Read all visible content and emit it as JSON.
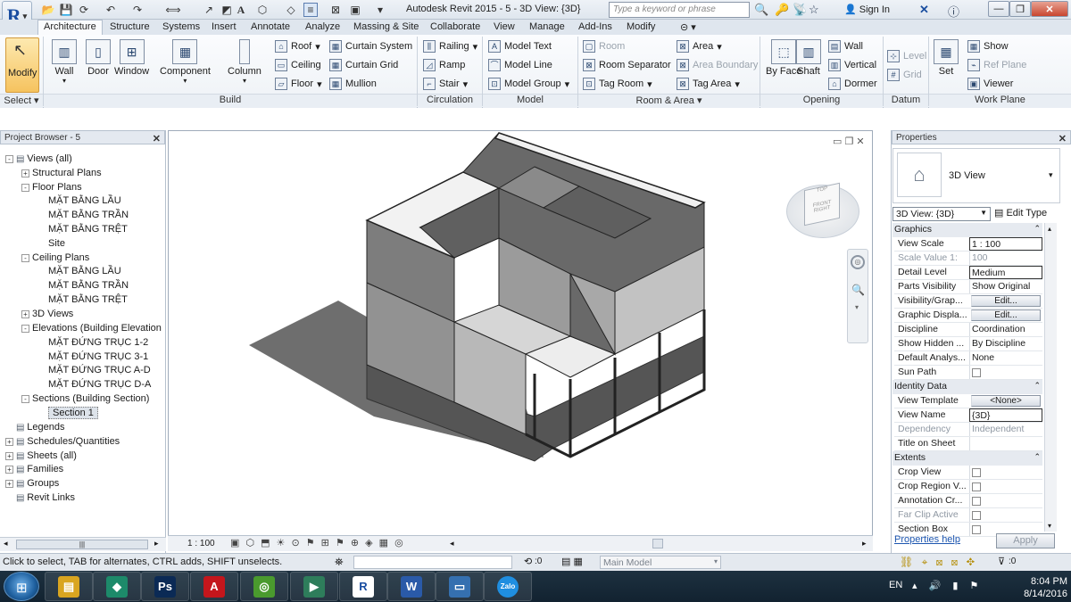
{
  "title_bar": {
    "app_button_letter": "R",
    "window_title": "Autodesk Revit 2015  -  5 - 3D View: {3D}",
    "search_placeholder": "Type a keyword or phrase",
    "sign_in": "Sign In"
  },
  "ribbon_tabs": [
    "Architecture",
    "Structure",
    "Systems",
    "Insert",
    "Annotate",
    "Analyze",
    "Massing & Site",
    "Collaborate",
    "View",
    "Manage",
    "Add-Ins",
    "Modify"
  ],
  "active_tab": "Architecture",
  "ribbon": {
    "select_panel": {
      "modify": "Modify",
      "footer": "Select"
    },
    "build_panel": {
      "wall": "Wall",
      "door": "Door",
      "window": "Window",
      "component": "Component",
      "column": "Column",
      "roof": "Roof",
      "ceiling": "Ceiling",
      "floor": "Floor",
      "curtain_system": "Curtain System",
      "curtain_grid": "Curtain Grid",
      "mullion": "Mullion",
      "footer": "Build"
    },
    "circulation_panel": {
      "railing": "Railing",
      "ramp": "Ramp",
      "stair": "Stair",
      "footer": "Circulation"
    },
    "model_panel": {
      "model_text": "Model Text",
      "model_line": "Model Line",
      "model_group": "Model Group",
      "footer": "Model"
    },
    "room_area_panel": {
      "room": "Room",
      "room_separator": "Room Separator",
      "tag_room": "Tag Room",
      "area": "Area",
      "area_boundary": "Area Boundary",
      "tag_area": "Tag Area",
      "footer": "Room & Area"
    },
    "opening_panel": {
      "by_face": "By Face",
      "shaft": "Shaft",
      "wall": "Wall",
      "vertical": "Vertical",
      "dormer": "Dormer",
      "footer": "Opening"
    },
    "datum_panel": {
      "level": "Level",
      "grid": "Grid",
      "footer": "Datum"
    },
    "work_plane_panel": {
      "set": "Set",
      "show": "Show",
      "ref_plane": "Ref Plane",
      "viewer": "Viewer",
      "footer": "Work Plane"
    }
  },
  "project_browser": {
    "title": "Project Browser - 5",
    "nodes": [
      {
        "label": "Views (all)",
        "indent": 0,
        "toggle": "-"
      },
      {
        "label": "Structural Plans",
        "indent": 1,
        "toggle": "+"
      },
      {
        "label": "Floor Plans",
        "indent": 1,
        "toggle": "-"
      },
      {
        "label": "MẶT BẰNG LẦU",
        "indent": 2,
        "toggle": ""
      },
      {
        "label": "MẶT BẰNG TRẦN",
        "indent": 2,
        "toggle": ""
      },
      {
        "label": "MẶT BẰNG TRỆT",
        "indent": 2,
        "toggle": ""
      },
      {
        "label": "Site",
        "indent": 2,
        "toggle": ""
      },
      {
        "label": "Ceiling Plans",
        "indent": 1,
        "toggle": "-"
      },
      {
        "label": "MẶT BẰNG LẦU",
        "indent": 2,
        "toggle": ""
      },
      {
        "label": "MẶT BẰNG TRẦN",
        "indent": 2,
        "toggle": ""
      },
      {
        "label": "MẶT BẰNG TRỆT",
        "indent": 2,
        "toggle": ""
      },
      {
        "label": "3D Views",
        "indent": 1,
        "toggle": "+"
      },
      {
        "label": "Elevations (Building Elevation",
        "indent": 1,
        "toggle": "-"
      },
      {
        "label": "MẶT ĐỨNG TRỤC 1-2",
        "indent": 2,
        "toggle": ""
      },
      {
        "label": "MẶT ĐỨNG TRỤC 3-1",
        "indent": 2,
        "toggle": ""
      },
      {
        "label": "MẶT ĐỨNG TRỤC A-D",
        "indent": 2,
        "toggle": ""
      },
      {
        "label": "MẶT ĐỨNG TRỤC D-A",
        "indent": 2,
        "toggle": ""
      },
      {
        "label": "Sections (Building Section)",
        "indent": 1,
        "toggle": "-"
      },
      {
        "label": "Section 1",
        "indent": 2,
        "toggle": "",
        "selected": true
      },
      {
        "label": "Legends",
        "indent": 0,
        "toggle": ""
      },
      {
        "label": "Schedules/Quantities",
        "indent": 0,
        "toggle": "+"
      },
      {
        "label": "Sheets (all)",
        "indent": 0,
        "toggle": "+"
      },
      {
        "label": "Families",
        "indent": 0,
        "toggle": "+"
      },
      {
        "label": "Groups",
        "indent": 0,
        "toggle": "+"
      },
      {
        "label": "Revit Links",
        "indent": 0,
        "toggle": ""
      }
    ]
  },
  "view_control": {
    "scale": "1 : 100"
  },
  "view_cube": {
    "top": "TOP",
    "front": "FRONT",
    "right": "RIGHT"
  },
  "properties": {
    "title": "Properties",
    "type_name": "3D View",
    "selector_value": "3D View: {3D}",
    "edit_type": "Edit Type",
    "groups": [
      {
        "name": "Graphics",
        "rows": [
          {
            "k": "View Scale",
            "v": "1 : 100",
            "input": true
          },
          {
            "k": "Scale Value    1:",
            "v": "100",
            "dim": true
          },
          {
            "k": "Detail Level",
            "v": "Medium",
            "input": true
          },
          {
            "k": "Parts Visibility",
            "v": "Show Original"
          },
          {
            "k": "Visibility/Grap...",
            "v": "Edit...",
            "button": true
          },
          {
            "k": "Graphic Displa...",
            "v": "Edit...",
            "button": true
          },
          {
            "k": "Discipline",
            "v": "Coordination"
          },
          {
            "k": "Show Hidden ...",
            "v": "By Discipline"
          },
          {
            "k": "Default Analys...",
            "v": "None"
          },
          {
            "k": "Sun Path",
            "v": "",
            "checkbox": true
          }
        ]
      },
      {
        "name": "Identity Data",
        "rows": [
          {
            "k": "View Template",
            "v": "<None>",
            "button": true
          },
          {
            "k": "View Name",
            "v": "{3D}",
            "input": true
          },
          {
            "k": "Dependency",
            "v": "Independent",
            "dim": true
          },
          {
            "k": "Title on Sheet",
            "v": ""
          }
        ]
      },
      {
        "name": "Extents",
        "rows": [
          {
            "k": "Crop View",
            "v": "",
            "checkbox": true
          },
          {
            "k": "Crop Region V...",
            "v": "",
            "checkbox": true
          },
          {
            "k": "Annotation Cr...",
            "v": "",
            "checkbox": true
          },
          {
            "k": "Far Clip Active",
            "v": "",
            "checkbox": true,
            "dim": true
          },
          {
            "k": "Section Box",
            "v": "",
            "checkbox": true
          }
        ]
      }
    ],
    "help_link": "Properties help",
    "apply": "Apply"
  },
  "status_bar": {
    "message": "Click to select, TAB for alternates, CTRL adds, SHIFT unselects.",
    "worksets": ":0",
    "design_option": "Main Model",
    "filter_count": ":0"
  },
  "taskbar": {
    "apps": [
      "Windows Explorer",
      "Gem App",
      "Photoshop",
      "Autodesk",
      "Green App",
      "Camtasia",
      "Revit",
      "Word",
      "Remote Desktop",
      "Zalo"
    ],
    "language": "EN",
    "time": "8:04 PM",
    "date": "8/14/2016"
  }
}
